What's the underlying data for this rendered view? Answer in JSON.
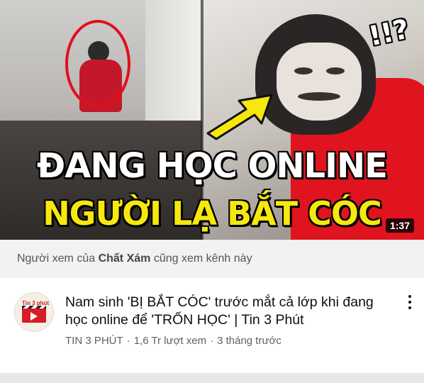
{
  "video": {
    "thumbnail": {
      "headline_line1": "ĐANG HỌC ONLINE",
      "headline_line2": "NGƯỜI LẠ BẮT CÓC",
      "sticker": "!!?",
      "duration": "1:37"
    },
    "title": "Nam sinh 'BỊ BẮT CÓC' trước mắt cả lớp khi đang học online để 'TRỐN HỌC' | Tin 3 Phút",
    "channel": "TIN 3 PHÚT",
    "views": "1,6 Tr lượt xem",
    "age": "3 tháng trước",
    "separator": "·",
    "avatar_text": "Tin 3 phút"
  },
  "recommendation": {
    "prefix": "Người xem của ",
    "channel_name": "Chất Xám",
    "suffix": " cũng xem kênh này"
  },
  "icons": {
    "more": "more-vert-icon",
    "arrow": "arrow-icon"
  },
  "colors": {
    "headline_white": "#ffffff",
    "headline_yellow": "#f6e80d",
    "highlight_red": "#e0101c",
    "banner_bg": "#f2f2f2",
    "meta_text": "#606060"
  }
}
